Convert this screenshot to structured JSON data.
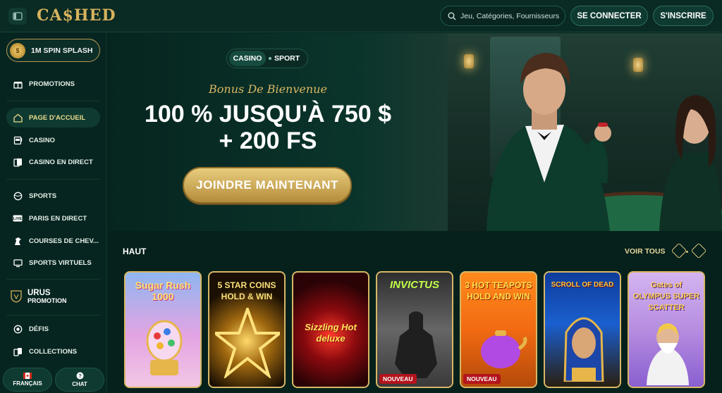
{
  "header": {
    "logo": "CA$HED",
    "search_placeholder": "Jeu, Catégories, Fournisseurs",
    "login_label": "SE CONNECTER",
    "signup_label": "S'INSCRIRE"
  },
  "sidebar": {
    "spin_label": "1M SPIN SPLASH",
    "items": [
      {
        "label": "PROMOTIONS",
        "icon": "gift-icon"
      },
      {
        "label": "PAGE D'ACCUEIL",
        "icon": "home-icon"
      },
      {
        "label": "CASINO",
        "icon": "slot-machine-icon"
      },
      {
        "label": "CASINO EN DIRECT",
        "icon": "cards-icon"
      },
      {
        "label": "SPORTS",
        "icon": "ball-icon"
      },
      {
        "label": "PARIS EN DIRECT",
        "icon": "live-icon"
      },
      {
        "label": "COURSES DE CHEV...",
        "icon": "horse-icon"
      },
      {
        "label": "SPORTS VIRTUELS",
        "icon": "screen-icon"
      },
      {
        "label": "DÉFIS",
        "icon": "target-icon"
      },
      {
        "label": "COLLECTIONS",
        "icon": "collection-icon"
      }
    ],
    "urus_title": "URUS",
    "urus_subtitle": "PROMOTION",
    "language_label": "FRANÇAIS",
    "chat_label": "CHAT"
  },
  "hero": {
    "tab_casino": "CASINO",
    "tab_sport": "SPORT",
    "bonus_label": "Bonus De Bienvenue",
    "headline_line1": "100 % JUSQU'À 750 $",
    "headline_line2": "+ 200 FS",
    "cta_label": "JOINDRE MAINTENANT"
  },
  "games": {
    "section_title": "HAUT",
    "see_all": "VOIR TOUS",
    "cards": [
      {
        "title": "Sugar Rush 1000",
        "badge": ""
      },
      {
        "title": "5 STAR COINS HOLD & WIN",
        "badge": ""
      },
      {
        "title": "Sizzling Hot deluxe",
        "badge": ""
      },
      {
        "title": "INVICTUS",
        "badge": "NOUVEAU"
      },
      {
        "title": "3 HOT TEAPOTS HOLD AND WIN",
        "badge": "NOUVEAU"
      },
      {
        "title": "SCROLL OF DEAD",
        "badge": ""
      },
      {
        "title": "Gates of OLYMPUS SUPER SCATTER",
        "badge": ""
      }
    ]
  },
  "colors": {
    "background": "#06211c",
    "accent_gold": "#d6b25e",
    "active_nav_text": "#eadb8c",
    "badge_red": "#b3141c"
  }
}
